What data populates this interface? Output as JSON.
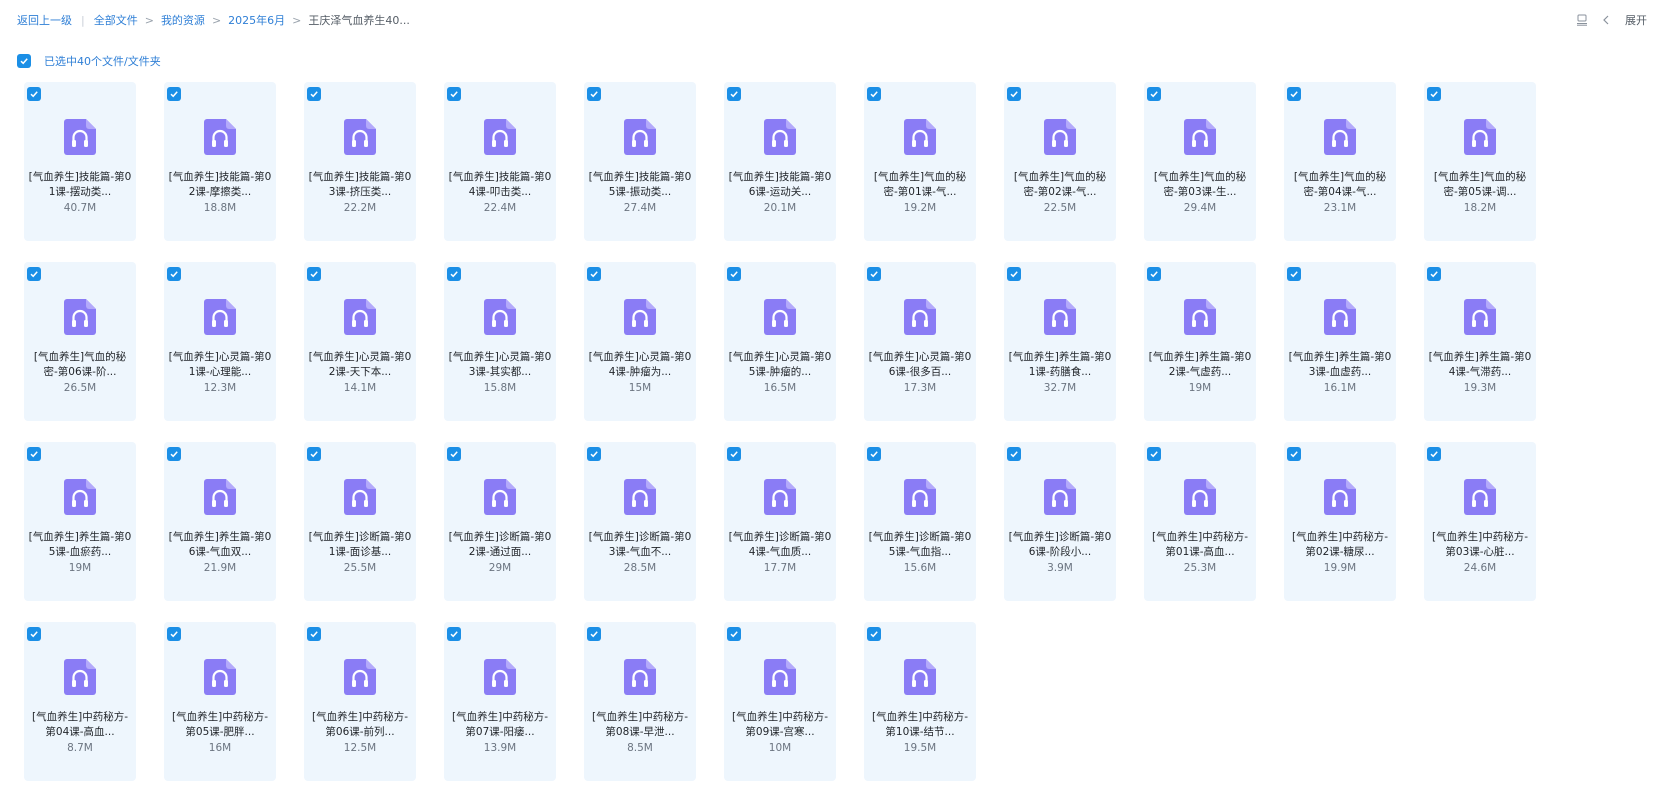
{
  "breadcrumb": {
    "back": "返回上一级",
    "items": [
      "全部文件",
      "我的资源",
      "2025年6月",
      "王庆泽气血养生40..."
    ]
  },
  "toolbar": {
    "expand_label": "展开"
  },
  "selection": {
    "label": "已选中40个文件/文件夹"
  },
  "colors": {
    "accent": "#1b8fe6",
    "card_bg": "#eef6fd",
    "icon_purple": "#8a7cf5"
  },
  "icons": {
    "file": "headphones-audio-icon",
    "check": "check-icon"
  },
  "files": [
    {
      "name": "[气血养生]技能篇-第01课-摆动类...",
      "size": "40.7M"
    },
    {
      "name": "[气血养生]技能篇-第02课-摩擦类...",
      "size": "18.8M"
    },
    {
      "name": "[气血养生]技能篇-第03课-挤压类...",
      "size": "22.2M"
    },
    {
      "name": "[气血养生]技能篇-第04课-叩击类...",
      "size": "22.4M"
    },
    {
      "name": "[气血养生]技能篇-第05课-振动类...",
      "size": "27.4M"
    },
    {
      "name": "[气血养生]技能篇-第06课-运动关...",
      "size": "20.1M"
    },
    {
      "name": "[气血养生]气血的秘密-第01课-气...",
      "size": "19.2M"
    },
    {
      "name": "[气血养生]气血的秘密-第02课-气...",
      "size": "22.5M"
    },
    {
      "name": "[气血养生]气血的秘密-第03课-生...",
      "size": "29.4M"
    },
    {
      "name": "[气血养生]气血的秘密-第04课-气...",
      "size": "23.1M"
    },
    {
      "name": "[气血养生]气血的秘密-第05课-调...",
      "size": "18.2M"
    },
    {
      "name": "[气血养生]气血的秘密-第06课-阶...",
      "size": "26.5M"
    },
    {
      "name": "[气血养生]心灵篇-第01课-心理能...",
      "size": "12.3M"
    },
    {
      "name": "[气血养生]心灵篇-第02课-天下本...",
      "size": "14.1M"
    },
    {
      "name": "[气血养生]心灵篇-第03课-其实都...",
      "size": "15.8M"
    },
    {
      "name": "[气血养生]心灵篇-第04课-肿瘤为...",
      "size": "15M"
    },
    {
      "name": "[气血养生]心灵篇-第05课-肿瘤的...",
      "size": "16.5M"
    },
    {
      "name": "[气血养生]心灵篇-第06课-很多百...",
      "size": "17.3M"
    },
    {
      "name": "[气血养生]养生篇-第01课-药膳食...",
      "size": "32.7M"
    },
    {
      "name": "[气血养生]养生篇-第02课-气虚药...",
      "size": "19M"
    },
    {
      "name": "[气血养生]养生篇-第03课-血虚药...",
      "size": "16.1M"
    },
    {
      "name": "[气血养生]养生篇-第04课-气滞药...",
      "size": "19.3M"
    },
    {
      "name": "[气血养生]养生篇-第05课-血瘀药...",
      "size": "19M"
    },
    {
      "name": "[气血养生]养生篇-第06课-气血双...",
      "size": "21.9M"
    },
    {
      "name": "[气血养生]诊断篇-第01课-面诊基...",
      "size": "25.5M"
    },
    {
      "name": "[气血养生]诊断篇-第02课-通过面...",
      "size": "29M"
    },
    {
      "name": "[气血养生]诊断篇-第03课-气血不...",
      "size": "28.5M"
    },
    {
      "name": "[气血养生]诊断篇-第04课-气血质...",
      "size": "17.7M"
    },
    {
      "name": "[气血养生]诊断篇-第05课-气血指...",
      "size": "15.6M"
    },
    {
      "name": "[气血养生]诊断篇-第06课-阶段小...",
      "size": "3.9M"
    },
    {
      "name": "[气血养生]中药秘方-第01课-高血...",
      "size": "25.3M"
    },
    {
      "name": "[气血养生]中药秘方-第02课-糖尿...",
      "size": "19.9M"
    },
    {
      "name": "[气血养生]中药秘方-第03课-心脏...",
      "size": "24.6M"
    },
    {
      "name": "[气血养生]中药秘方-第04课-高血...",
      "size": "8.7M"
    },
    {
      "name": "[气血养生]中药秘方-第05课-肥胖...",
      "size": "16M"
    },
    {
      "name": "[气血养生]中药秘方-第06课-前列...",
      "size": "12.5M"
    },
    {
      "name": "[气血养生]中药秘方-第07课-阳痿...",
      "size": "13.9M"
    },
    {
      "name": "[气血养生]中药秘方-第08课-早泄...",
      "size": "8.5M"
    },
    {
      "name": "[气血养生]中药秘方-第09课-宫寒...",
      "size": "10M"
    },
    {
      "name": "[气血养生]中药秘方-第10课-结节...",
      "size": "19.5M"
    }
  ]
}
